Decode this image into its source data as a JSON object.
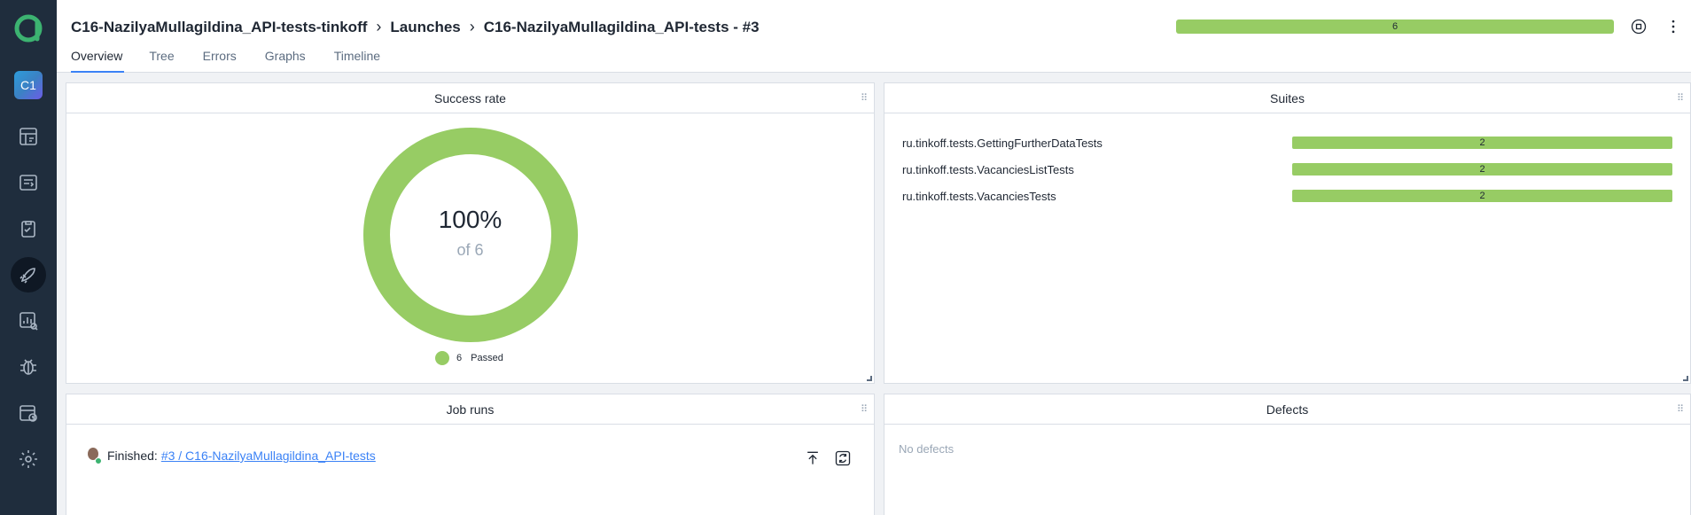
{
  "app": {
    "logo_icon": "allure-logo-icon",
    "project_badge": "C1"
  },
  "sidebar": {
    "items": [
      {
        "icon": "dashboard-icon"
      },
      {
        "icon": "test-cases-icon"
      },
      {
        "icon": "test-plans-icon"
      },
      {
        "icon": "launches-icon",
        "active": true
      },
      {
        "icon": "analytics-icon"
      },
      {
        "icon": "defects-icon"
      },
      {
        "icon": "jobs-icon"
      },
      {
        "icon": "settings-icon"
      }
    ]
  },
  "header": {
    "breadcrumb": [
      "C16-NazilyaMullagildina_API-tests-tinkoff",
      "Launches",
      "C16-NazilyaMullagildina_API-tests - #3"
    ],
    "progress_count": "6",
    "progress_color": "#97cc64",
    "tabs": [
      "Overview",
      "Tree",
      "Errors",
      "Graphs",
      "Timeline"
    ],
    "active_tab": "Overview"
  },
  "success_rate": {
    "title": "Success rate",
    "percent": "100%",
    "of_total": "of 6",
    "legend_count": "6",
    "legend_label": "Passed",
    "passed_color": "#97cc64"
  },
  "suites": {
    "title": "Suites",
    "rows": [
      {
        "name": "ru.tinkoff.tests.GettingFurtherDataTests",
        "count": "2"
      },
      {
        "name": "ru.tinkoff.tests.VacanciesListTests",
        "count": "2"
      },
      {
        "name": "ru.tinkoff.tests.VacanciesTests",
        "count": "2"
      }
    ]
  },
  "job_runs": {
    "title": "Job runs",
    "status": "Finished:",
    "link": "#3 / C16-NazilyaMullagildina_API-tests"
  },
  "defects": {
    "title": "Defects",
    "empty_text": "No defects"
  }
}
